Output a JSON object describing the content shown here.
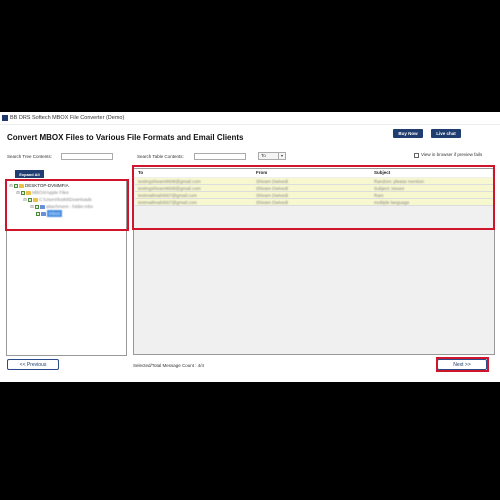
{
  "window": {
    "title": "BB DRS Softech MBOX File Converter (Demo)",
    "heading": "Convert MBOX Files to Various File Formats and Email Clients"
  },
  "header": {
    "buy_now": "Buy Now",
    "live_chat": "Live chat"
  },
  "search": {
    "tree_label": "Search Tree Contents:",
    "tree_value": "",
    "table_label": "Search Table Contents:",
    "table_value": "",
    "field_select": "To",
    "preview_label": "View in browser if preview fails"
  },
  "tree": {
    "expand_all": "Expand All",
    "nodes": [
      {
        "label": "DESKTOP-DVMMFIA"
      },
      {
        "label": "MBOX/Apple Files"
      },
      {
        "label": "C:\\Users\\fuskit\\Downloads"
      },
      {
        "label": "attachment - folder.mbx"
      },
      {
        "label": "Inbox"
      }
    ]
  },
  "table": {
    "columns": [
      "To",
      "From",
      "Subject"
    ],
    "rows": [
      {
        "to": "testingshivam8608@gmail.com",
        "from": "Shivam Dwivedi",
        "subject": "Random: please mention"
      },
      {
        "to": "testingshivam8608@gmail.com",
        "from": "Shivam Dwivedi",
        "subject": "Subject: issues"
      },
      {
        "to": "testmailmail4567@gmail.com",
        "from": "Shivam Dwivedi",
        "subject": "Ram"
      },
      {
        "to": "testmailmail4567@gmail.com",
        "from": "Shivam Dwivedi",
        "subject": "multiple language"
      }
    ]
  },
  "footer": {
    "previous": "<< Previous",
    "status": "Selected/Total Message Count : 4/4",
    "next": "Next >>"
  },
  "colors": {
    "accent": "#1f3d6e",
    "highlight": "#d0142c",
    "row_bg": "#f7f7d0"
  }
}
